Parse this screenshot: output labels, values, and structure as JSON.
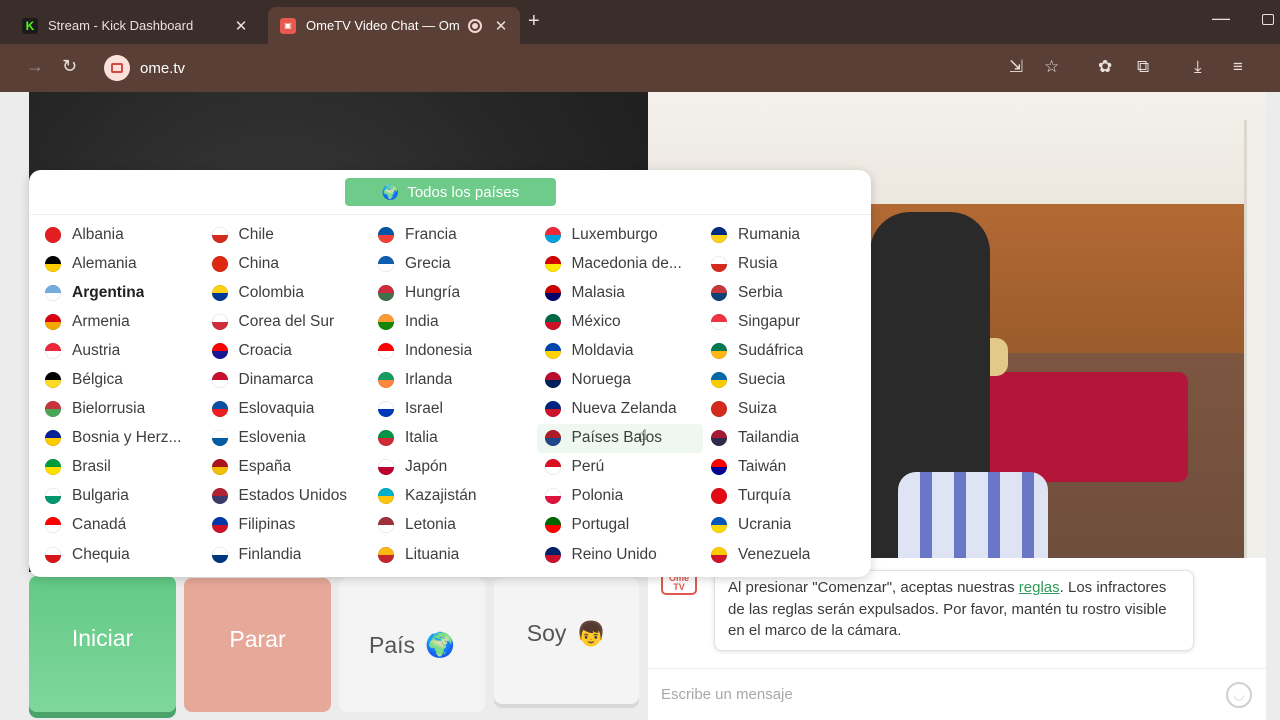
{
  "browser": {
    "tabs": [
      {
        "title": "Stream - Kick Dashboard",
        "favicon": "kick-icon"
      },
      {
        "title": "OmeTV Video Chat — Ome",
        "favicon": "ometv-icon",
        "active": true
      }
    ],
    "url": "ome.tv"
  },
  "country_panel": {
    "all_label": "Todos los países",
    "countries": [
      {
        "name": "Albania",
        "colors": [
          "#e41e20",
          "#e41e20"
        ]
      },
      {
        "name": "Chile",
        "colors": [
          "#ffffff",
          "#d52b1e"
        ]
      },
      {
        "name": "Francia",
        "colors": [
          "#0055a4",
          "#ef4135"
        ]
      },
      {
        "name": "Luxemburgo",
        "colors": [
          "#ed2939",
          "#00a1de"
        ]
      },
      {
        "name": "Rumania",
        "colors": [
          "#002b7f",
          "#fcd116"
        ]
      },
      {
        "name": "Alemania",
        "colors": [
          "#000000",
          "#ffce00"
        ]
      },
      {
        "name": "China",
        "colors": [
          "#de2910",
          "#de2910"
        ]
      },
      {
        "name": "Grecia",
        "colors": [
          "#0d5eaf",
          "#ffffff"
        ]
      },
      {
        "name": "Macedonia de...",
        "colors": [
          "#d20000",
          "#ffe600"
        ]
      },
      {
        "name": "Rusia",
        "colors": [
          "#ffffff",
          "#d52b1e"
        ]
      },
      {
        "name": "Argentina",
        "colors": [
          "#74acdf",
          "#ffffff"
        ],
        "bold": true
      },
      {
        "name": "Colombia",
        "colors": [
          "#fcd116",
          "#003893"
        ]
      },
      {
        "name": "Hungría",
        "colors": [
          "#cd2a3e",
          "#436f4d"
        ]
      },
      {
        "name": "Malasia",
        "colors": [
          "#cc0001",
          "#010066"
        ]
      },
      {
        "name": "Serbia",
        "colors": [
          "#c6363c",
          "#0c4076"
        ]
      },
      {
        "name": "Armenia",
        "colors": [
          "#d90012",
          "#f2a800"
        ]
      },
      {
        "name": "Corea del Sur",
        "colors": [
          "#ffffff",
          "#cd2e3a"
        ]
      },
      {
        "name": "India",
        "colors": [
          "#ff9933",
          "#138808"
        ]
      },
      {
        "name": "México",
        "colors": [
          "#006847",
          "#ce1126"
        ]
      },
      {
        "name": "Singapur",
        "colors": [
          "#ef3340",
          "#ffffff"
        ]
      },
      {
        "name": "Austria",
        "colors": [
          "#ed2939",
          "#ffffff"
        ]
      },
      {
        "name": "Croacia",
        "colors": [
          "#ff0000",
          "#171796"
        ]
      },
      {
        "name": "Indonesia",
        "colors": [
          "#ff0000",
          "#ffffff"
        ]
      },
      {
        "name": "Moldavia",
        "colors": [
          "#0046ae",
          "#ffd200"
        ]
      },
      {
        "name": "Sudáfrica",
        "colors": [
          "#007a4d",
          "#ffb612"
        ]
      },
      {
        "name": "Bélgica",
        "colors": [
          "#000000",
          "#fdda24"
        ]
      },
      {
        "name": "Dinamarca",
        "colors": [
          "#c8102e",
          "#ffffff"
        ]
      },
      {
        "name": "Irlanda",
        "colors": [
          "#169b62",
          "#ff883e"
        ]
      },
      {
        "name": "Noruega",
        "colors": [
          "#ba0c2f",
          "#00205b"
        ]
      },
      {
        "name": "Suecia",
        "colors": [
          "#006aa7",
          "#fecc00"
        ]
      },
      {
        "name": "Bielorrusia",
        "colors": [
          "#c8313e",
          "#4aa657"
        ]
      },
      {
        "name": "Eslovaquia",
        "colors": [
          "#0b4ea2",
          "#ee1c25"
        ]
      },
      {
        "name": "Israel",
        "colors": [
          "#ffffff",
          "#0038b8"
        ]
      },
      {
        "name": "Nueva Zelanda",
        "colors": [
          "#00247d",
          "#cc142b"
        ]
      },
      {
        "name": "Suiza",
        "colors": [
          "#d52b1e",
          "#d52b1e"
        ]
      },
      {
        "name": "Bosnia y Herz...",
        "colors": [
          "#002395",
          "#fecb00"
        ]
      },
      {
        "name": "Eslovenia",
        "colors": [
          "#ffffff",
          "#005da4"
        ]
      },
      {
        "name": "Italia",
        "colors": [
          "#009246",
          "#ce2b37"
        ]
      },
      {
        "name": "Países Bajos",
        "colors": [
          "#ae1c28",
          "#21468b"
        ],
        "hover": true
      },
      {
        "name": "Tailandia",
        "colors": [
          "#a51931",
          "#2d2a4a"
        ]
      },
      {
        "name": "Brasil",
        "colors": [
          "#009c3b",
          "#ffdf00"
        ]
      },
      {
        "name": "España",
        "colors": [
          "#aa151b",
          "#f1bf00"
        ]
      },
      {
        "name": "Japón",
        "colors": [
          "#ffffff",
          "#bc002d"
        ]
      },
      {
        "name": "Perú",
        "colors": [
          "#d91023",
          "#ffffff"
        ]
      },
      {
        "name": "Taiwán",
        "colors": [
          "#fe0000",
          "#000095"
        ]
      },
      {
        "name": "Bulgaria",
        "colors": [
          "#ffffff",
          "#00966e"
        ]
      },
      {
        "name": "Estados Unidos",
        "colors": [
          "#b22234",
          "#3c3b6e"
        ]
      },
      {
        "name": "Kazajistán",
        "colors": [
          "#00afca",
          "#fec50c"
        ]
      },
      {
        "name": "Polonia",
        "colors": [
          "#ffffff",
          "#dc143c"
        ]
      },
      {
        "name": "Turquía",
        "colors": [
          "#e30a17",
          "#e30a17"
        ]
      },
      {
        "name": "Canadá",
        "colors": [
          "#ff0000",
          "#ffffff"
        ]
      },
      {
        "name": "Filipinas",
        "colors": [
          "#0038a8",
          "#ce1126"
        ]
      },
      {
        "name": "Letonia",
        "colors": [
          "#9e3039",
          "#ffffff"
        ]
      },
      {
        "name": "Portugal",
        "colors": [
          "#006600",
          "#ff0000"
        ]
      },
      {
        "name": "Ucrania",
        "colors": [
          "#0057b7",
          "#ffd700"
        ]
      },
      {
        "name": "Chequia",
        "colors": [
          "#ffffff",
          "#d7141a"
        ]
      },
      {
        "name": "Finlandia",
        "colors": [
          "#ffffff",
          "#003580"
        ]
      },
      {
        "name": "Lituania",
        "colors": [
          "#fdb913",
          "#c1272d"
        ]
      },
      {
        "name": "Reino Unido",
        "colors": [
          "#012169",
          "#c8102e"
        ]
      },
      {
        "name": "Venezuela",
        "colors": [
          "#ffcc00",
          "#cf142b"
        ]
      }
    ]
  },
  "controls": {
    "start_label": "Iniciar",
    "stop_label": "Parar",
    "country_label": "País",
    "country_icon": "🌍",
    "gender_label": "Soy",
    "gender_icon": "👦"
  },
  "chat": {
    "logo_line1": "Ome",
    "logo_line2": "TV",
    "rules_before": "Al presionar \"Comenzar\", aceptas nuestras ",
    "rules_link": "reglas",
    "rules_after": ". Los infractores de las reglas serán expulsados. Por favor, mantén tu rostro visible en el marco de la cámara.",
    "input_placeholder": "Escribe un mensaje"
  },
  "colors": {
    "accent_green": "#6fcb8a",
    "stop_red": "#e6a898",
    "link_green": "#2f9a58"
  }
}
